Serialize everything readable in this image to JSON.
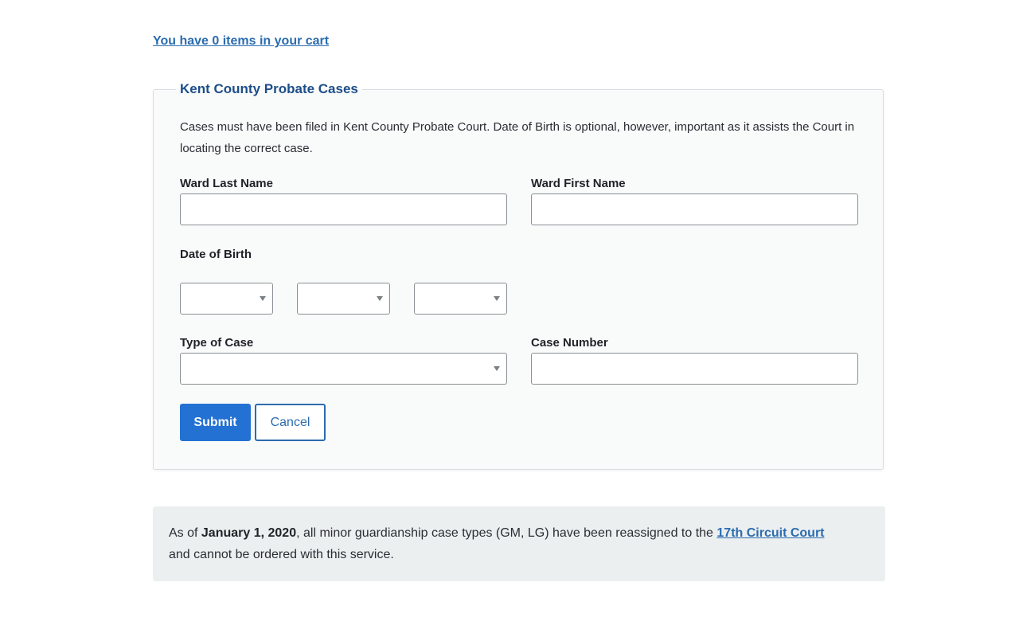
{
  "cart": {
    "link_text": "You have 0 items in your cart"
  },
  "form": {
    "legend": "Kent County Probate Cases",
    "intro": "Cases must have been filed in Kent County Probate Court. Date of Birth is optional, however, important as it assists the Court in locating the correct case.",
    "ward_last_name": {
      "label": "Ward Last Name",
      "value": ""
    },
    "ward_first_name": {
      "label": "Ward First Name",
      "value": ""
    },
    "date_of_birth": {
      "label": "Date of Birth",
      "month_value": "",
      "day_value": "",
      "year_value": ""
    },
    "type_of_case": {
      "label": "Type of Case",
      "value": ""
    },
    "case_number": {
      "label": "Case Number",
      "value": ""
    },
    "submit_label": "Submit",
    "cancel_label": "Cancel"
  },
  "notice": {
    "prefix": "As of ",
    "date": "January 1, 2020",
    "middle": ", all minor guardianship case types (GM, LG) have been reassigned to the ",
    "link_text": "17th Circuit Court",
    "suffix": " and cannot be ordered with this service."
  },
  "colors": {
    "accent": "#2371d3",
    "link": "#2b6cb0",
    "legend": "#1d4e89",
    "notice_bg": "#eceff0"
  },
  "icons": {
    "select_caret": "caret-down-icon"
  }
}
